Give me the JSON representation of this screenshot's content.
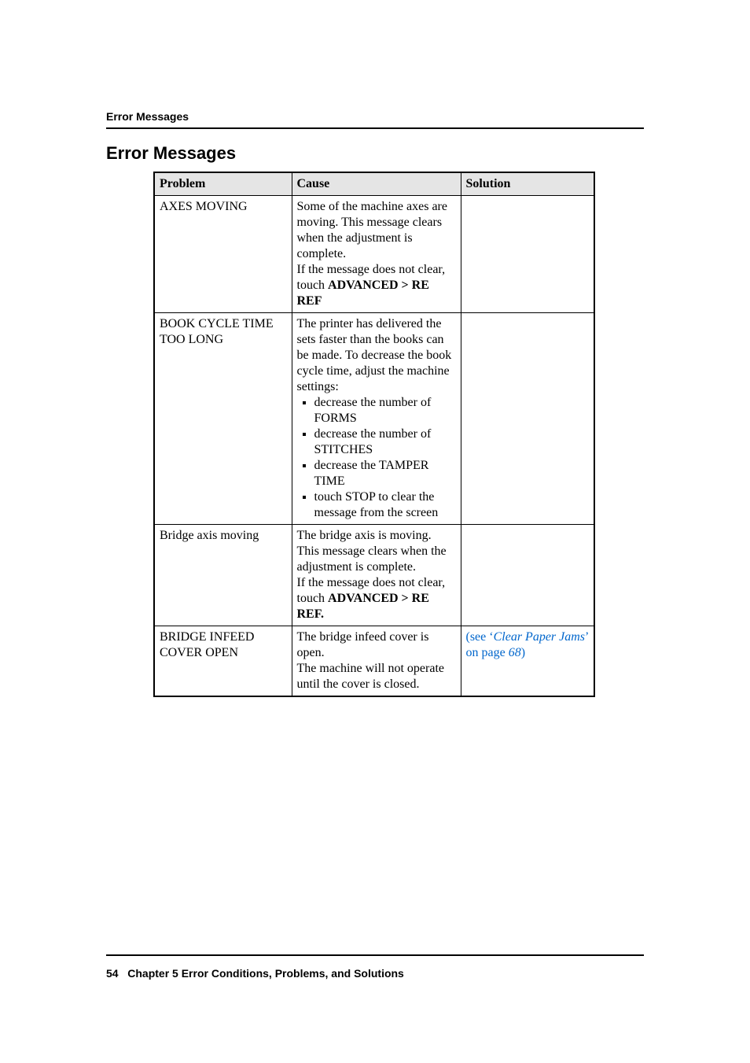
{
  "running_head": "Error Messages",
  "section_title": "Error Messages",
  "headers": {
    "problem": "Problem",
    "cause": "Cause",
    "solution": "Solution"
  },
  "rows": {
    "r0": {
      "problem": "AXES MOVING",
      "cause_p1": "Some of the machine axes are moving. This message clears when the adjustment is complete.",
      "cause_p2a": "If the message does not clear, touch ",
      "cause_p2b": "ADVANCED > RE REF",
      "solution": ""
    },
    "r1": {
      "problem": "BOOK CYCLE TIME TOO LONG",
      "cause_p1": "The printer has delivered the sets faster than the books can be made. To decrease the book cycle time, adjust the machine settings:",
      "bullets": {
        "b0": "decrease the number of FORMS",
        "b1": "decrease the number of STITCHES",
        "b2": "decrease the TAMPER TIME",
        "b3": "touch STOP to clear the message from the screen"
      },
      "solution": ""
    },
    "r2": {
      "problem": "Bridge axis moving",
      "cause_p1": "The bridge axis is moving. This message clears when the adjustment is complete.",
      "cause_p2a": "If the message does not clear, touch ",
      "cause_p2b": "ADVANCED > RE REF.",
      "solution": ""
    },
    "r3": {
      "problem": "BRIDGE INFEED COVER OPEN",
      "cause_p1": "The bridge infeed cover is open.",
      "cause_p2": "The machine will not operate until the cover is closed.",
      "solution_a": "(see ‘",
      "solution_b": "Clear Paper Jams",
      "solution_c": "’ on page ",
      "solution_d": "68",
      "solution_e": ")"
    }
  },
  "footer": {
    "page_no": "54",
    "chapter": "Chapter 5 Error Conditions, Problems, and Solutions"
  }
}
